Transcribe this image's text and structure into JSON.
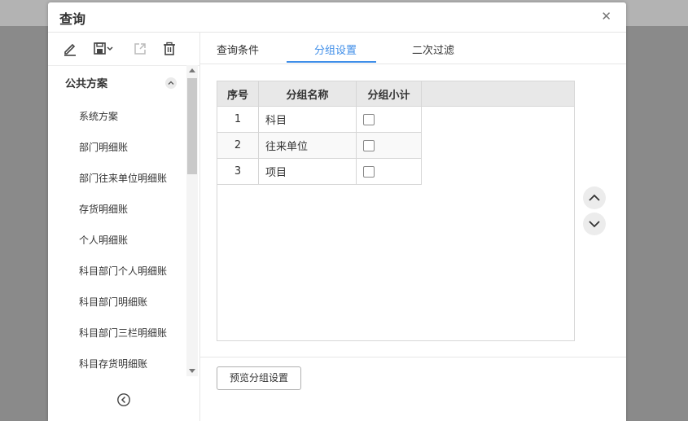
{
  "dialog": {
    "title": "查询",
    "close_glyph": "✕"
  },
  "sidebar": {
    "group_label": "公共方案",
    "items": [
      {
        "label": "系统方案"
      },
      {
        "label": "部门明细账"
      },
      {
        "label": "部门往来单位明细账"
      },
      {
        "label": "存货明细账"
      },
      {
        "label": "个人明细账"
      },
      {
        "label": "科目部门个人明细账"
      },
      {
        "label": "科目部门明细账"
      },
      {
        "label": "科目部门三栏明细账"
      },
      {
        "label": "科目存货明细账"
      }
    ],
    "toolbar_icons": [
      "edit-icon",
      "save-icon",
      "export-icon",
      "delete-icon"
    ]
  },
  "tabs": [
    {
      "label": "查询条件"
    },
    {
      "label": "分组设置",
      "active": true
    },
    {
      "label": "二次过滤"
    }
  ],
  "grid": {
    "headers": [
      "序号",
      "分组名称",
      "分组小计"
    ],
    "rows": [
      {
        "index": "1",
        "name": "科目",
        "subtotal": false
      },
      {
        "index": "2",
        "name": "往来单位",
        "subtotal": false
      },
      {
        "index": "3",
        "name": "项目",
        "subtotal": false
      }
    ]
  },
  "footer": {
    "preview_label": "预览分组设置"
  },
  "colors": {
    "accent": "#3f8ee8",
    "header_bg": "#e8e8e8",
    "overlay": "#8a8a8a"
  }
}
